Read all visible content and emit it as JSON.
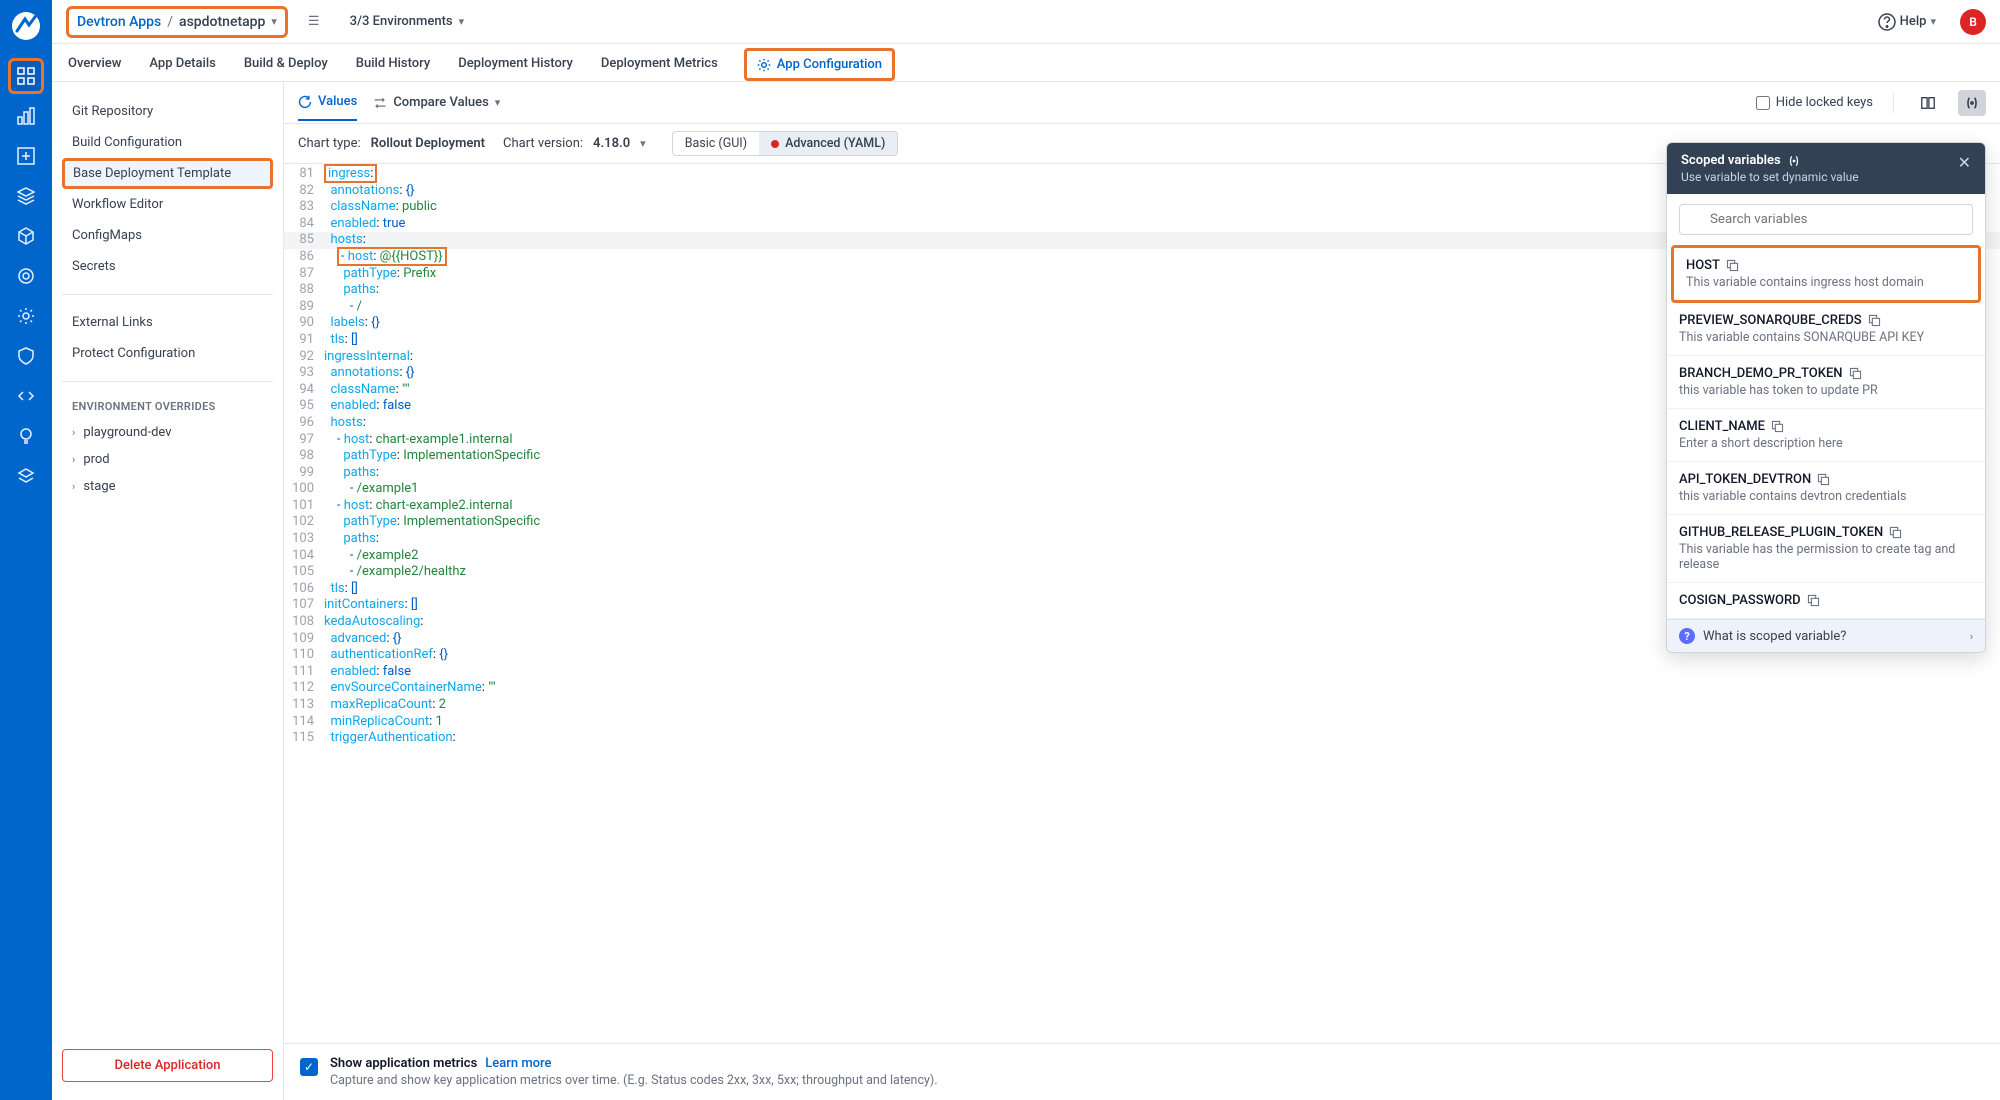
{
  "breadcrumb": {
    "root": "Devtron Apps",
    "app": "aspdotnetapp"
  },
  "env_filter": "3/3 Environments",
  "help_label": "Help",
  "avatar_initial": "B",
  "tabs": {
    "overview": "Overview",
    "app_details": "App Details",
    "build_deploy": "Build & Deploy",
    "build_history": "Build History",
    "deployment_history": "Deployment History",
    "deployment_metrics": "Deployment Metrics",
    "app_config": "App Configuration"
  },
  "sidebar": {
    "git": "Git Repository",
    "build": "Build Configuration",
    "base": "Base Deployment Template",
    "workflow": "Workflow Editor",
    "configmaps": "ConfigMaps",
    "secrets": "Secrets",
    "external": "External Links",
    "protect": "Protect Configuration",
    "overrides_title": "ENVIRONMENT OVERRIDES",
    "envs": [
      "playground-dev",
      "prod",
      "stage"
    ],
    "delete": "Delete Application"
  },
  "toolbar": {
    "values": "Values",
    "compare": "Compare Values",
    "hide_locked": "Hide locked keys"
  },
  "chartbar": {
    "type_label": "Chart type:",
    "type_value": "Rollout Deployment",
    "ver_label": "Chart version:",
    "ver_value": "4.18.0",
    "basic": "Basic (GUI)",
    "advanced": "Advanced (YAML)"
  },
  "footer": {
    "title": "Show application metrics",
    "learn": "Learn more",
    "sub": "Capture and show key application metrics over time. (E.g. Status codes 2xx, 3xx, 5xx; throughput and latency)."
  },
  "panel": {
    "title": "Scoped variables",
    "sub": "Use variable to set dynamic value",
    "search_placeholder": "Search variables",
    "vars": [
      {
        "name": "HOST",
        "desc": "This variable contains ingress host domain"
      },
      {
        "name": "PREVIEW_SONARQUBE_CREDS",
        "desc": "This variable contains SONARQUBE API KEY"
      },
      {
        "name": "BRANCH_DEMO_PR_TOKEN",
        "desc": "this variable has token to update PR"
      },
      {
        "name": "CLIENT_NAME",
        "desc": "Enter a short description here"
      },
      {
        "name": "API_TOKEN_DEVTRON",
        "desc": "this variable contains devtron credentials"
      },
      {
        "name": "GITHUB_RELEASE_PLUGIN_TOKEN",
        "desc": "This variable has the permission to create tag and release"
      },
      {
        "name": "COSIGN_PASSWORD",
        "desc": ""
      }
    ],
    "foot": "What is scoped variable?"
  },
  "yaml_lines": [
    {
      "n": 81,
      "boxed": true,
      "i": 0,
      "key": "ingress",
      "val": null,
      "vtype": null
    },
    {
      "n": 82,
      "i": 1,
      "key": "annotations",
      "val": "{}",
      "vtype": "sym"
    },
    {
      "n": 83,
      "i": 1,
      "key": "className",
      "val": "public",
      "vtype": "str"
    },
    {
      "n": 84,
      "i": 1,
      "key": "enabled",
      "val": "true",
      "vtype": "bool"
    },
    {
      "n": 85,
      "i": 1,
      "key": "hosts",
      "val": null,
      "vtype": null,
      "active": true
    },
    {
      "n": 86,
      "i": 2,
      "dash": true,
      "key": "host",
      "val": "@{{HOST}}",
      "vtype": "str",
      "boxed": true
    },
    {
      "n": 87,
      "i": 3,
      "key": "pathType",
      "val": "Prefix",
      "vtype": "str"
    },
    {
      "n": 88,
      "i": 3,
      "key": "paths",
      "val": null,
      "vtype": null
    },
    {
      "n": 89,
      "i": 4,
      "dash": true,
      "plain": "/"
    },
    {
      "n": 90,
      "i": 1,
      "key": "labels",
      "val": "{}",
      "vtype": "sym"
    },
    {
      "n": 91,
      "i": 1,
      "key": "tls",
      "val": "[]",
      "vtype": "sym"
    },
    {
      "n": 92,
      "i": 0,
      "key": "ingressInternal",
      "val": null,
      "vtype": null
    },
    {
      "n": 93,
      "i": 1,
      "key": "annotations",
      "val": "{}",
      "vtype": "sym"
    },
    {
      "n": 94,
      "i": 1,
      "key": "className",
      "val": "\"\"",
      "vtype": "str"
    },
    {
      "n": 95,
      "i": 1,
      "key": "enabled",
      "val": "false",
      "vtype": "bool"
    },
    {
      "n": 96,
      "i": 1,
      "key": "hosts",
      "val": null,
      "vtype": null
    },
    {
      "n": 97,
      "i": 2,
      "dash": true,
      "key": "host",
      "val": "chart-example1.internal",
      "vtype": "str"
    },
    {
      "n": 98,
      "i": 3,
      "key": "pathType",
      "val": "ImplementationSpecific",
      "vtype": "str"
    },
    {
      "n": 99,
      "i": 3,
      "key": "paths",
      "val": null,
      "vtype": null
    },
    {
      "n": 100,
      "i": 4,
      "dash": true,
      "plain": "/example1"
    },
    {
      "n": 101,
      "i": 2,
      "dash": true,
      "key": "host",
      "val": "chart-example2.internal",
      "vtype": "str"
    },
    {
      "n": 102,
      "i": 3,
      "key": "pathType",
      "val": "ImplementationSpecific",
      "vtype": "str"
    },
    {
      "n": 103,
      "i": 3,
      "key": "paths",
      "val": null,
      "vtype": null
    },
    {
      "n": 104,
      "i": 4,
      "dash": true,
      "plain": "/example2"
    },
    {
      "n": 105,
      "i": 4,
      "dash": true,
      "plain": "/example2/healthz"
    },
    {
      "n": 106,
      "i": 1,
      "key": "tls",
      "val": "[]",
      "vtype": "sym"
    },
    {
      "n": 107,
      "i": 0,
      "key": "initContainers",
      "val": "[]",
      "vtype": "sym"
    },
    {
      "n": 108,
      "i": 0,
      "key": "kedaAutoscaling",
      "val": null,
      "vtype": null
    },
    {
      "n": 109,
      "i": 1,
      "key": "advanced",
      "val": "{}",
      "vtype": "sym"
    },
    {
      "n": 110,
      "i": 1,
      "key": "authenticationRef",
      "val": "{}",
      "vtype": "sym"
    },
    {
      "n": 111,
      "i": 1,
      "key": "enabled",
      "val": "false",
      "vtype": "bool"
    },
    {
      "n": 112,
      "i": 1,
      "key": "envSourceContainerName",
      "val": "\"\"",
      "vtype": "str"
    },
    {
      "n": 113,
      "i": 1,
      "key": "maxReplicaCount",
      "val": "2",
      "vtype": "num"
    },
    {
      "n": 114,
      "i": 1,
      "key": "minReplicaCount",
      "val": "1",
      "vtype": "num"
    },
    {
      "n": 115,
      "i": 1,
      "key": "triggerAuthentication",
      "val": null,
      "vtype": null
    }
  ]
}
